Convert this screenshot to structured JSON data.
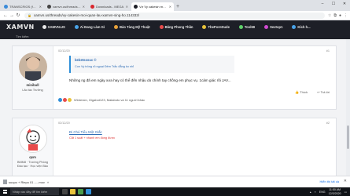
{
  "browser": {
    "tabs": [
      {
        "title": "TRANSCRIOS (fVEPROFILE (the...",
        "favicon_color": "#3b8bd9",
        "active": false
      },
      {
        "title": "xamvn.us/threads/ny-cakesin...",
        "favicon_color": "#444444",
        "active": false
      },
      {
        "title": "Downloads - MEGA",
        "favicon_color": "#d9272e",
        "active": false
      },
      {
        "title": "Vợ Vy cakesin mơi quan lấu xamvn...",
        "favicon_color": "#1d1f27",
        "active": true
      }
    ],
    "new_tab": "+",
    "window_controls": [
      "–",
      "☐",
      "✕"
    ],
    "url": "xamvn.us/threads/vy-cakesin-moi-quan-lau-xamvn-sing-ho.114333/"
  },
  "site": {
    "logo": "XAMVN",
    "nav": [
      {
        "label": "XAMVN.US",
        "icon": "home-icon",
        "color": "#e8e8e8"
      },
      {
        "label": "Ai Đang Làm Gì",
        "icon": "chat-icon",
        "color": "#49a3e8"
      },
      {
        "label": "Bảo Tàng Mỹ Thuật",
        "icon": "art-icon",
        "color": "#e8a23b"
      },
      {
        "label": "Băng Phong Thần",
        "icon": "flag-icon",
        "color": "#e84b4b"
      },
      {
        "label": "ThePornDude",
        "icon": "dude-icon",
        "color": "#e8c33b"
      },
      {
        "label": "Tool69",
        "icon": "tool-icon",
        "color": "#5fd16a"
      },
      {
        "label": "Sextop1",
        "icon": "star-icon",
        "color": "#d14bd1"
      },
      {
        "label": "Kích h...",
        "icon": "user-icon",
        "color": "#49a3e8"
      }
    ],
    "subnav_label": "Tìm kiếm"
  },
  "posts": [
    {
      "username": "minibull",
      "rank": "Lão tác Trưởng",
      "date": "02/12/20",
      "number": "#1",
      "quote_author": "bebetsosuc ©",
      "quote_text": "Con Vy trông rõ ngoại Đêm Trắc đẳng ko nhỉ",
      "text": "Những ng đã em ngày xưa hay có thể đến nhậu do chính tay chồng em phục vụ. 1cảm giác rồi JAV...",
      "actions": [
        "Thích",
        "Trả lời"
      ],
      "reactions": "Wintersin, Gigabot123, Malaboto và 11 người khác"
    },
    {
      "username": "qsm",
      "rank": "BMM8 · Trường Phòng",
      "rank2": "Đào tạo · Học viện Bảo",
      "date": "02/12/20",
      "number": "#2",
      "title": "Đi Chú Tiểu Một Giấc",
      "subtitle": "Cắt 1 suất + nhanh em đóng được",
      "actions": []
    }
  ],
  "downloads": {
    "item": "suupo + Riepo 01 -....mov",
    "show_all": "Hiển thị tất cả",
    "close": "✕"
  },
  "taskbar": {
    "search_placeholder": "Nhập vào đây để tìm kiếm",
    "time": "11:50 AM",
    "date": "12/3/2020",
    "lang": "ENG"
  }
}
